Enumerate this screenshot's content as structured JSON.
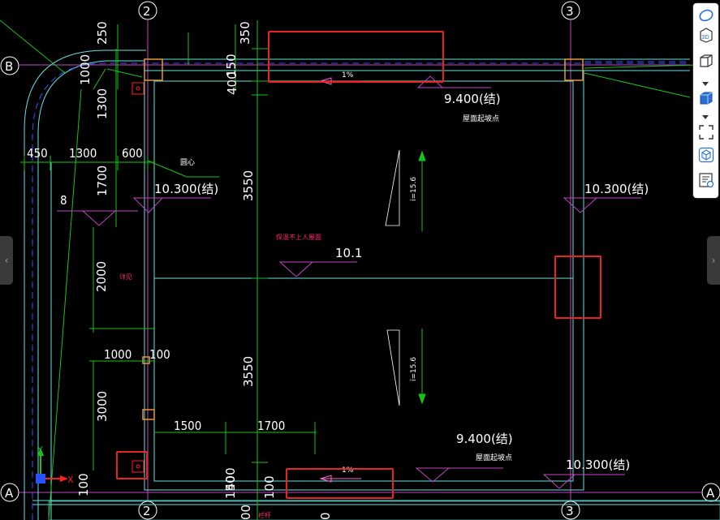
{
  "axes": {
    "col_2": "2",
    "col_3": "3",
    "row_A": "A",
    "row_B": "B"
  },
  "dimensions": {
    "d250": "250",
    "d350": "350",
    "d150": "150",
    "d400": "400",
    "d1000_top": "1000",
    "d1300_v": "1300",
    "d450": "450",
    "d1300_h": "1300",
    "d600": "600",
    "d1700_v": "1700",
    "d3550_top": "3550",
    "d8": "8",
    "d2000": "2000",
    "d1000_h": "1000",
    "d100_h": "100",
    "d3550_bot": "3550",
    "d3000": "3000",
    "d1500": "1500",
    "d1700_h": "1700",
    "d400_bot": "400",
    "d150_bot": "150",
    "d100_bot": "100",
    "d100_bot2": "100",
    "d00": "00",
    "d0": "0"
  },
  "elevations": {
    "e_9400_top": "9.400(结)",
    "e_10300_left": "10.300(结)",
    "e_10300_right": "10.300(结)",
    "e_101": "10.1",
    "e_9400_bot": "9.400(结)",
    "e_10300_bot": "10.300(结)"
  },
  "notes": {
    "roof_start_top": "屋面起坡点",
    "roof_start_bot": "屋面起坡点",
    "slope_top": "i=15.6",
    "slope_bot": "i=15.6",
    "slope_1pct_top": "1%",
    "slope_1pct_bot": "1%",
    "circle_center": "圆心",
    "no_access_roof": "保温不上人屋面",
    "small_label_left": "详见",
    "bottom_label": "栏杆"
  },
  "ucs": {
    "y": "Y",
    "x": "X"
  },
  "toolbar": {
    "items": [
      "view-cube-icon",
      "3d-icon",
      "box-outline-icon",
      "box-solid-icon",
      "fullscreen-icon",
      "cube-hex-icon",
      "properties-icon"
    ],
    "accent": "#2b6fd6"
  },
  "colors": {
    "background": "#000000",
    "green": "#19c219",
    "cyan": "#66e0e0",
    "magenta": "#c445c4",
    "orange": "#e39a3a",
    "blue_dash": "#3b50ff",
    "highlight": "#e8241f"
  }
}
